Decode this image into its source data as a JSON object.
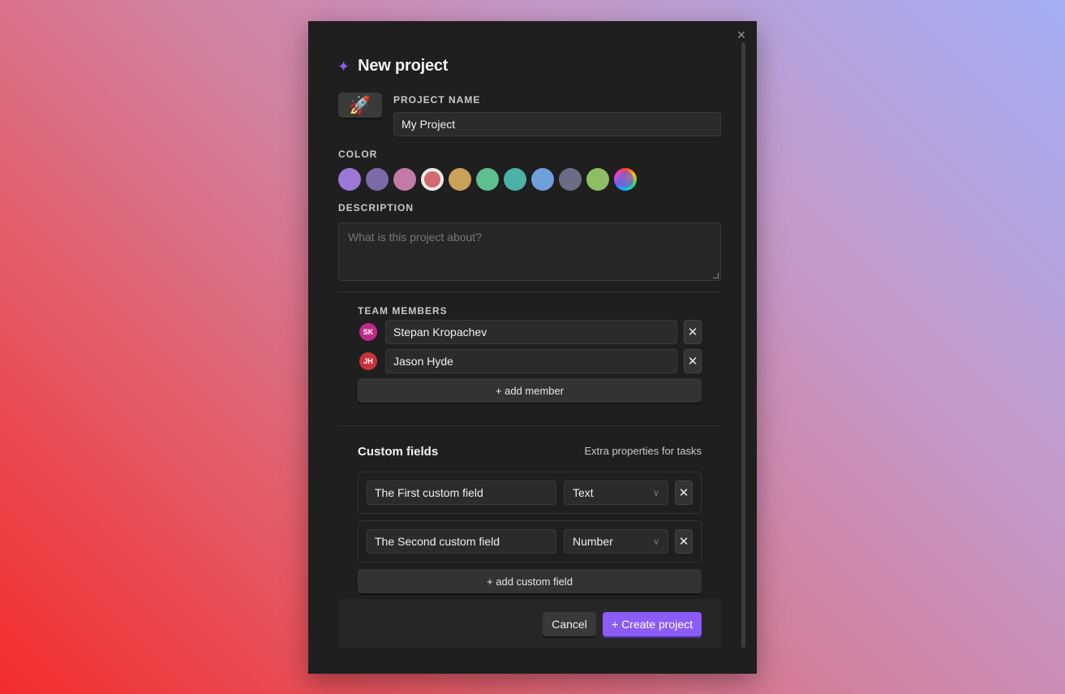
{
  "modal": {
    "title": "New project",
    "close_icon": "×",
    "sparkle_icon": "✦",
    "emoji": "🚀"
  },
  "project_name": {
    "label": "PROJECT NAME",
    "value": "My Project"
  },
  "color": {
    "label": "COLOR",
    "swatches": [
      "#9b78d6",
      "#7c69a8",
      "#c47aa9",
      "#d36a72",
      "#c9a25a",
      "#5fc08f",
      "#4cb1a6",
      "#6fa0dc",
      "#6c6c86",
      "#8fbd64",
      "rainbow"
    ],
    "selected_index": 3
  },
  "description": {
    "label": "DESCRIPTION",
    "placeholder": "What is this project about?"
  },
  "team": {
    "label": "TEAM MEMBERS",
    "members": [
      {
        "initials": "SK",
        "name": "Stepan Kropachev",
        "color": "#c02a8a"
      },
      {
        "initials": "JH",
        "name": "Jason Hyde",
        "color": "#c8323a"
      }
    ],
    "add_label": "+ add member",
    "remove_icon": "✕"
  },
  "custom_fields": {
    "title": "Custom fields",
    "subtitle": "Extra properties for tasks",
    "fields": [
      {
        "name": "The First custom field",
        "type": "Text"
      },
      {
        "name": "The Second custom field",
        "type": "Number"
      }
    ],
    "add_label": "+ add custom field",
    "chevron_icon": "∨",
    "remove_icon": "✕"
  },
  "footer": {
    "cancel_label": "Cancel",
    "create_label": "+ Create project"
  }
}
